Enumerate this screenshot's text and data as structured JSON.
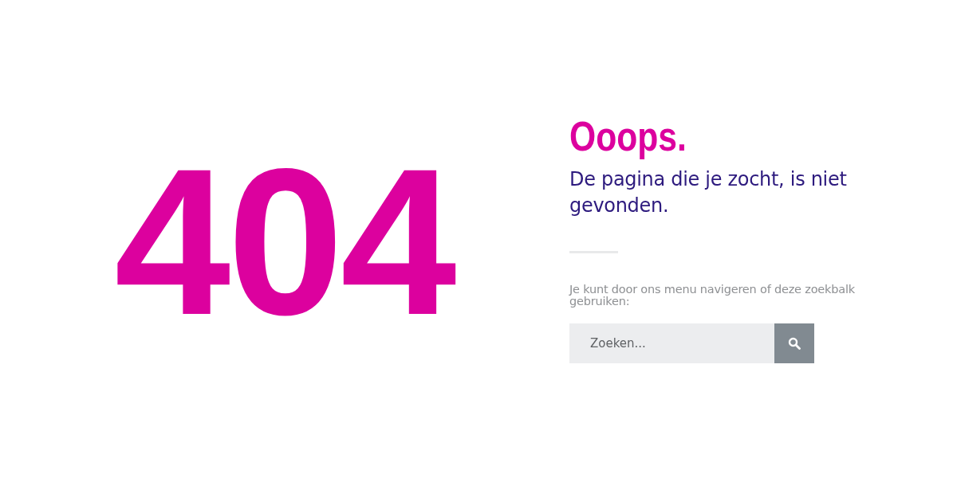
{
  "error_code": "404",
  "heading": "Ooops.",
  "message": "De pagina die je zocht, is niet gevonden.",
  "hint": "Je kunt door ons menu navigeren of deze zoekbalk gebruiken:",
  "search": {
    "placeholder": "Zoeken..."
  }
}
